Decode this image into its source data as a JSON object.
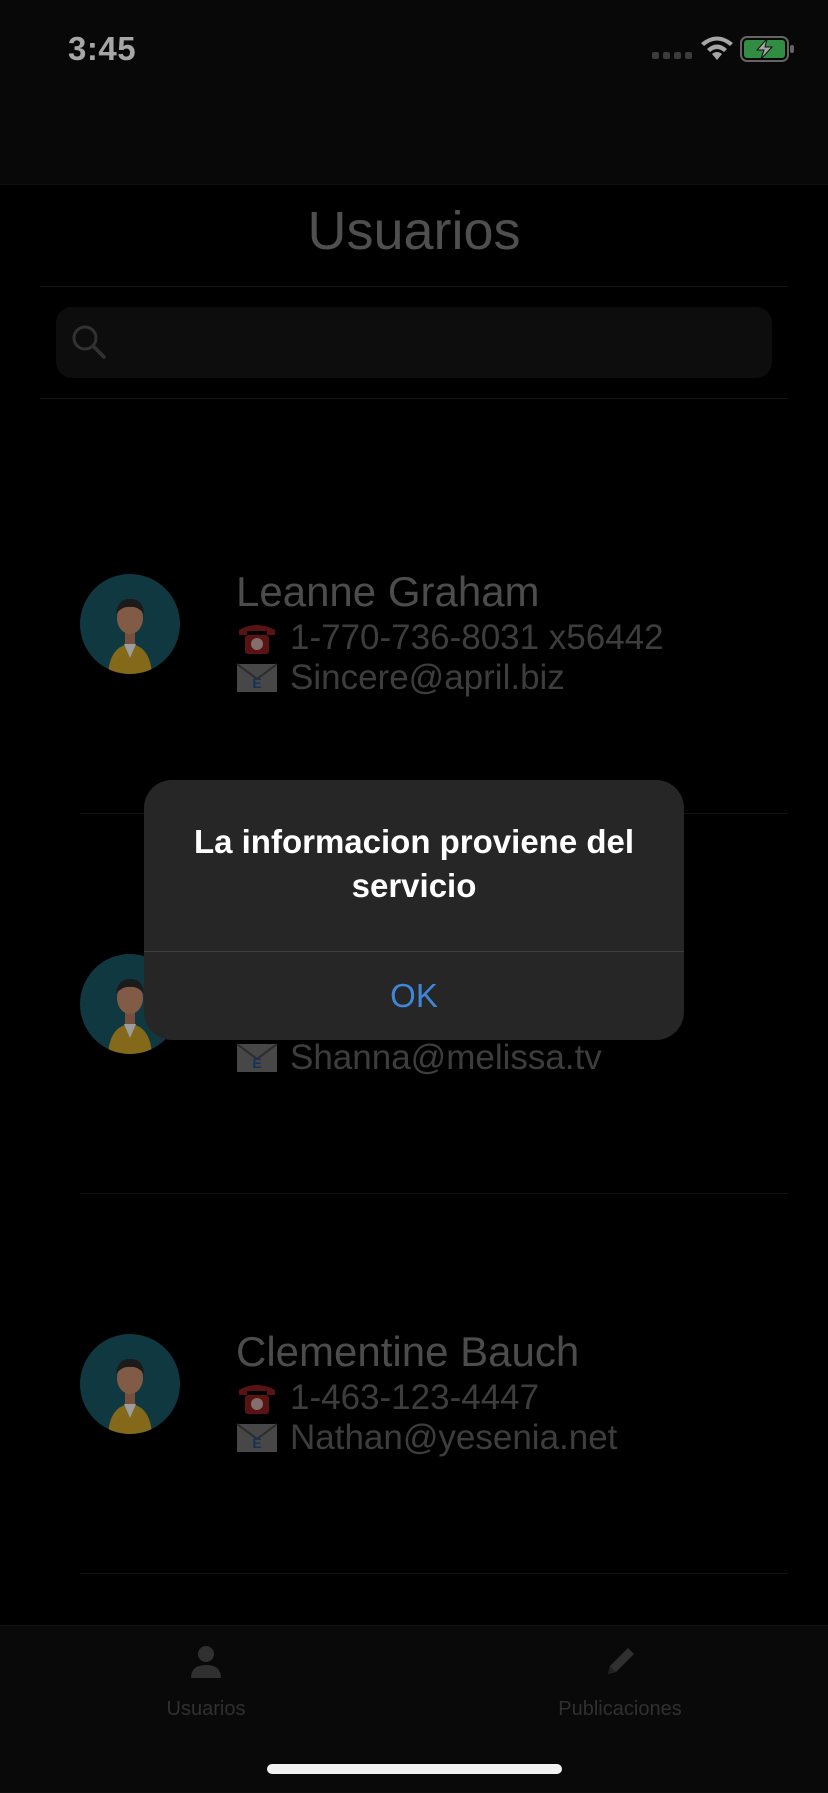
{
  "status_bar": {
    "time": "3:45"
  },
  "page": {
    "title": "Usuarios"
  },
  "search": {
    "placeholder": ""
  },
  "users": [
    {
      "name": "Leanne Graham",
      "phone": "1-770-736-8031 x56442",
      "email": "Sincere@april.biz"
    },
    {
      "name": "",
      "phone": "",
      "email": "Shanna@melissa.tv"
    },
    {
      "name": "Clementine Bauch",
      "phone": "1-463-123-4447",
      "email": "Nathan@yesenia.net"
    }
  ],
  "alert": {
    "title": "La informacion proviene del servicio",
    "ok_label": "OK"
  },
  "tab_bar": {
    "tabs": [
      {
        "label": "Usuarios",
        "icon": "person-icon"
      },
      {
        "label": "Publicaciones",
        "icon": "pencil-icon"
      }
    ]
  },
  "colors": {
    "accent": "#3f86d8",
    "avatar_bg": "#1a5763",
    "battery_fill": "#4cd964"
  }
}
